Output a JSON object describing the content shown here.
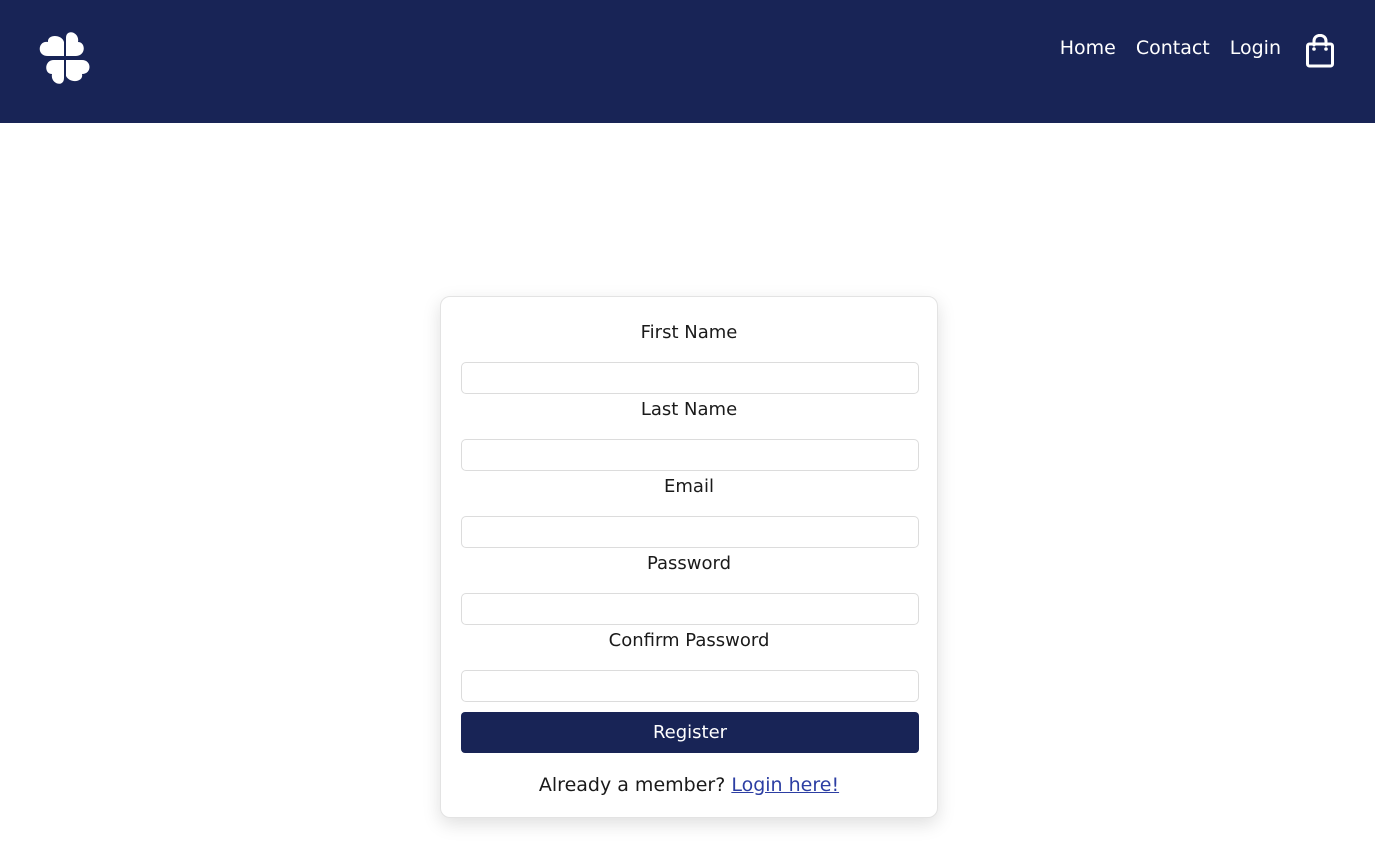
{
  "header": {
    "logo_icon": "clover-hearts-logo-icon",
    "nav": [
      {
        "label": "Home"
      },
      {
        "label": "Contact"
      },
      {
        "label": "Login"
      }
    ],
    "cart_icon": "shopping-bag-icon"
  },
  "form": {
    "fields": [
      {
        "label": "First Name",
        "value": ""
      },
      {
        "label": "Last Name",
        "value": ""
      },
      {
        "label": "Email",
        "value": ""
      },
      {
        "label": "Password",
        "value": ""
      },
      {
        "label": "Confirm Password",
        "value": ""
      }
    ],
    "submit_label": "Register",
    "member_prompt": "Already a member?",
    "login_link": "Login here!"
  },
  "colors": {
    "navy": "#182456",
    "link": "#2c3ea3"
  }
}
